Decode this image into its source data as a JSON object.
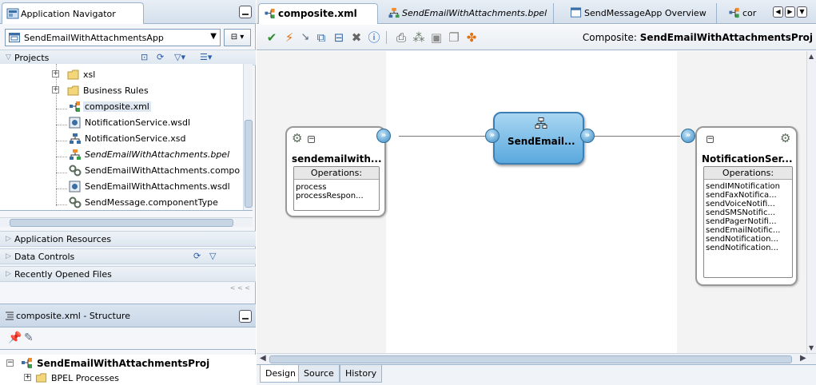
{
  "navigator": {
    "tab_title": "Application Navigator",
    "app_name": "SendEmailWithAttachmentsApp",
    "projects_label": "Projects",
    "tree": [
      {
        "label": "xsl",
        "icon": "folder-icon",
        "expand": "+"
      },
      {
        "label": "Business Rules",
        "icon": "folder-icon",
        "expand": "+"
      },
      {
        "label": "composite.xml",
        "icon": "composite-icon",
        "selected": true
      },
      {
        "label": "NotificationService.wsdl",
        "icon": "wsdl-icon"
      },
      {
        "label": "NotificationService.xsd",
        "icon": "xsd-icon"
      },
      {
        "label": "SendEmailWithAttachments.bpel",
        "icon": "bpel-icon",
        "italic": true
      },
      {
        "label": "SendEmailWithAttachments.compo",
        "icon": "componenttype-icon"
      },
      {
        "label": "SendEmailWithAttachments.wsdl",
        "icon": "wsdl-icon"
      },
      {
        "label": "SendMessage.componentType",
        "icon": "componenttype-icon"
      }
    ],
    "sections": {
      "app_resources": "Application Resources",
      "data_controls": "Data Controls",
      "recent_files": "Recently Opened Files"
    },
    "collapse_glyph": "< < <"
  },
  "structure": {
    "title": "composite.xml - Structure",
    "root": "SendEmailWithAttachmentsProj",
    "child": "BPEL Processes"
  },
  "editor": {
    "tabs": [
      {
        "label": "composite.xml",
        "active": true
      },
      {
        "label": "SendEmailWithAttachments.bpel",
        "italic": true
      },
      {
        "label": "SendMessageApp Overview"
      },
      {
        "label": "cor"
      }
    ],
    "composite_prefix": "Composite:",
    "composite_name": "SendEmailWithAttachmentsProj",
    "bottom_tabs": [
      "Design",
      "Source",
      "History"
    ]
  },
  "canvas": {
    "left_service": {
      "name": "sendemailwith...",
      "ops_header": "Operations:",
      "ops": [
        "process",
        "processRespon..."
      ]
    },
    "component": {
      "name": "SendEmail..."
    },
    "right_reference": {
      "name": "NotificationSer...",
      "ops_header": "Operations:",
      "ops": [
        "sendIMNotification",
        "sendFaxNotifica...",
        "sendVoiceNotifi...",
        "sendSMSNotific...",
        "sendPagerNotifi...",
        "sendEmailNotific...",
        "sendNotification...",
        "sendNotification..."
      ]
    }
  },
  "colors": {
    "accent": "#3d8cc4",
    "component_fill": "#5aa9de",
    "panel_border": "#9db3cc",
    "swimlane": "#f3f3f3"
  }
}
